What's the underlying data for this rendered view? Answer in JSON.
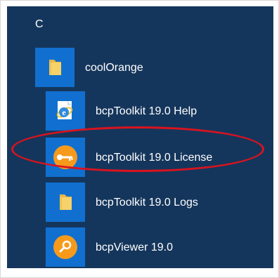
{
  "start_menu": {
    "group_letter": "C",
    "folder": {
      "label": "coolOrange",
      "icon": "folder-icon"
    },
    "items": [
      {
        "label": "bcpToolkit 19.0 Help",
        "icon": "internet-explorer-icon"
      },
      {
        "label": "bcpToolkit 19.0 License",
        "icon": "key-icon"
      },
      {
        "label": "bcpToolkit 19.0 Logs",
        "icon": "folder-icon"
      },
      {
        "label": "bcpViewer 19.0",
        "icon": "magnifier-icon"
      }
    ]
  },
  "annotation": {
    "highlighted_item": "bcpToolkit 19.0 License",
    "color": "#d9131f"
  },
  "colors": {
    "menu_background": "#15365c",
    "tile_blue": "#1170cf",
    "folder_yellow": "#f6d26a",
    "badge_orange": "#f79a1c"
  }
}
